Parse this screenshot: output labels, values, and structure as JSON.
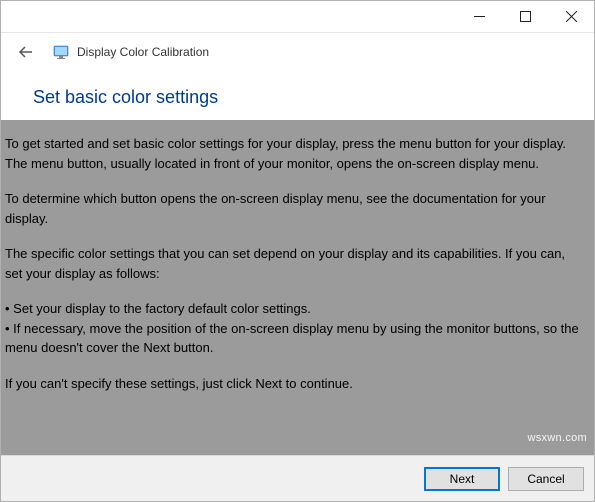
{
  "titlebar": {
    "minimize": "Minimize",
    "maximize": "Maximize",
    "close": "Close"
  },
  "header": {
    "back_label": "Back",
    "app_title": "Display Color Calibration"
  },
  "heading": "Set basic color settings",
  "body": {
    "p1": "To get started and set basic color settings for your display, press the menu button for your display. The menu button, usually located in front of your monitor, opens the on-screen display menu.",
    "p2": "To determine which button opens the on-screen display menu, see the documentation for your display.",
    "p3": "The specific color settings that you can set depend on your display and its capabilities. If you can, set your display as follows:",
    "b1": "• Set your display to the factory default color settings.",
    "b2": "• If necessary, move the position of the on-screen display menu by using the monitor buttons, so the menu doesn't cover the Next button.",
    "p4": "If you can't specify these settings,  just click Next to continue."
  },
  "footer": {
    "next": "Next",
    "cancel": "Cancel"
  },
  "watermark": "wsxwn.com"
}
